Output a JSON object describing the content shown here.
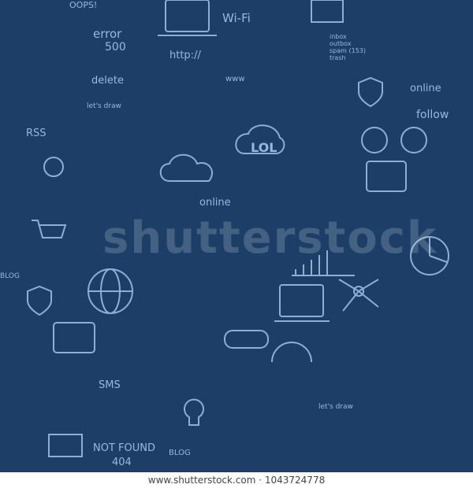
{
  "doodles": {
    "oops": "OOPS!",
    "error": "error",
    "error_code": "500",
    "delete": "delete",
    "http": "http://",
    "wifi": "Wi-Fi",
    "www": "www",
    "mail_folders": [
      "inbox",
      "outbox",
      "spam (153)",
      "trash"
    ],
    "online_top": "online",
    "follow": "follow",
    "rss": "RSS",
    "lets_draw": "let's draw",
    "lol": "LOL",
    "online_mid": "online",
    "blog_left": "BLOG",
    "sms": "SMS",
    "not_found": "NOT FOUND",
    "not_found_code": "404",
    "blog_bottom": "BLOG",
    "lets_draw_bottom": "let's draw"
  },
  "watermark": "shutterstock",
  "footer": "www.shutterstock.com · 1043724778",
  "colors": {
    "background": "#1d3f67",
    "doodle": "#9ab8db"
  }
}
